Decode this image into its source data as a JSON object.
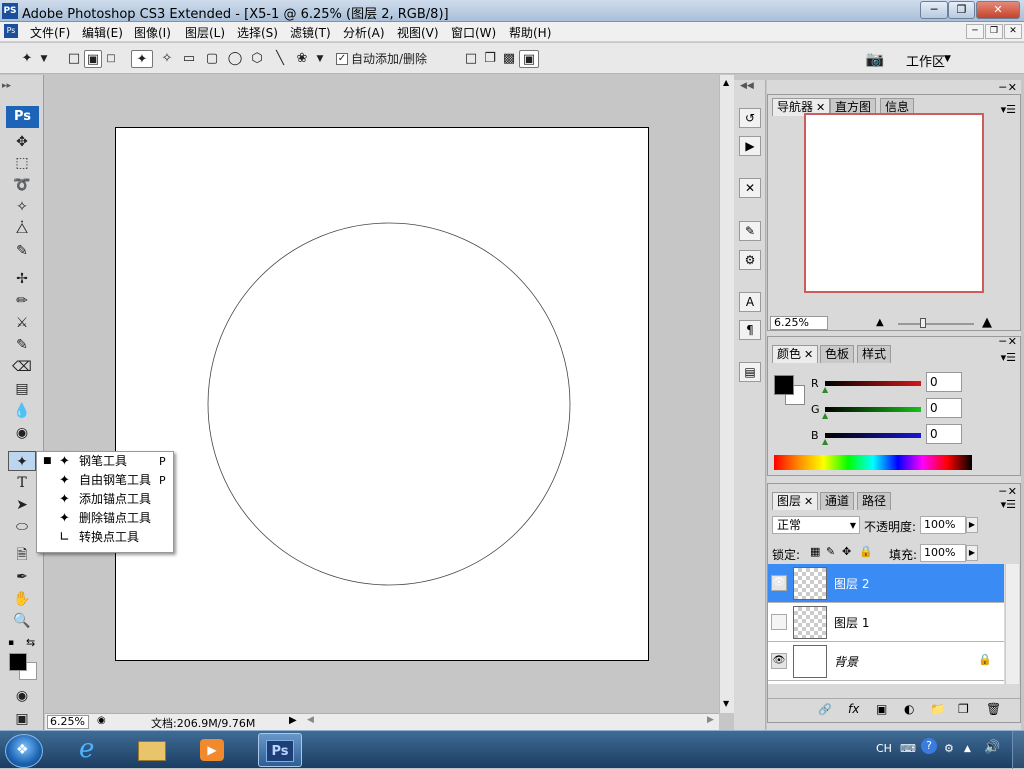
{
  "window": {
    "app_icon": "PS",
    "title": "Adobe Photoshop CS3 Extended - [X5-1 @ 6.25% (图层 2, RGB/8)]",
    "buttons": [
      "minimize-icon",
      "restore-icon",
      "close-icon"
    ]
  },
  "menu": {
    "items": [
      "文件(F)",
      "编辑(E)",
      "图像(I)",
      "图层(L)",
      "选择(S)",
      "滤镜(T)",
      "分析(A)",
      "视图(V)",
      "窗口(W)",
      "帮助(H)"
    ]
  },
  "options_bar": {
    "auto_add_delete_label": "自动添加/删除",
    "auto_add_delete_checked": true,
    "workspace_label": "工作区"
  },
  "tools": {
    "ps_badge": "Ps"
  },
  "pen_flyout": {
    "items": [
      {
        "label": "钢笔工具",
        "shortcut": "P",
        "selected": true
      },
      {
        "label": "自由钢笔工具",
        "shortcut": "P",
        "selected": false
      },
      {
        "label": "添加锚点工具",
        "shortcut": "",
        "selected": false
      },
      {
        "label": "删除锚点工具",
        "shortcut": "",
        "selected": false
      },
      {
        "label": "转换点工具",
        "shortcut": "",
        "selected": false
      }
    ]
  },
  "status": {
    "zoom": "6.25%",
    "doc_size": "文档:206.9M/9.76M"
  },
  "navigator_panel": {
    "tabs": [
      "导航器",
      "直方图",
      "信息"
    ],
    "zoom": "6.25%"
  },
  "color_panel": {
    "tabs": [
      "颜色",
      "色板",
      "样式"
    ],
    "channels": [
      {
        "label": "R",
        "value": "0",
        "color": "#d21818"
      },
      {
        "label": "G",
        "value": "0",
        "color": "#18c018"
      },
      {
        "label": "B",
        "value": "0",
        "color": "#1818d2"
      }
    ],
    "foreground": "#000000",
    "background": "#ffffff"
  },
  "layers_panel": {
    "tabs": [
      "图层",
      "通道",
      "路径"
    ],
    "blend_mode": "正常",
    "opacity_label": "不透明度:",
    "opacity": "100%",
    "lock_label": "锁定:",
    "fill_label": "填充:",
    "fill": "100%",
    "layers": [
      {
        "name": "图层 2",
        "visible": true,
        "selected": true,
        "locked": false,
        "transparent": true
      },
      {
        "name": "图层 1",
        "visible": false,
        "selected": false,
        "locked": false,
        "transparent": true
      },
      {
        "name": "背景",
        "visible": true,
        "selected": false,
        "locked": true,
        "transparent": false
      }
    ]
  },
  "taskbar": {
    "ps_label": "Ps",
    "language": "CH"
  }
}
